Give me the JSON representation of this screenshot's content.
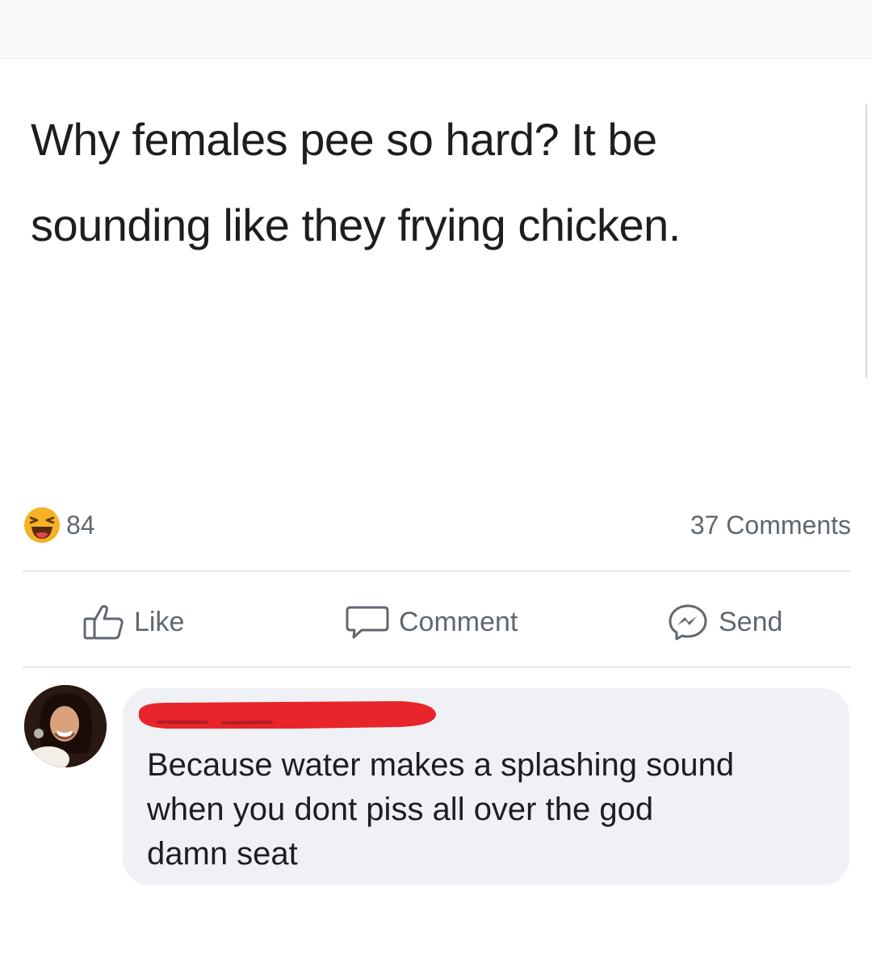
{
  "post": {
    "text_lines": [
      "Why females pee so hard? It be",
      "sounding like they frying chicken."
    ]
  },
  "stats": {
    "reaction_icon": "haha-emoji-icon",
    "reaction_count": "84",
    "comments_label": "37 Comments"
  },
  "actions": {
    "like_label": "Like",
    "comment_label": "Comment",
    "send_label": "Send"
  },
  "comment": {
    "author_name_redacted": true,
    "text_lines": [
      "Because water makes a splashing sound",
      "when you dont piss all over the god",
      "damn seat"
    ]
  },
  "colors": {
    "text": "#1c1e21",
    "muted": "#606770",
    "bubble": "#f0f1f4",
    "divider": "#e4e6eb",
    "redaction": "#e8252b",
    "haha": "#f7b125"
  }
}
